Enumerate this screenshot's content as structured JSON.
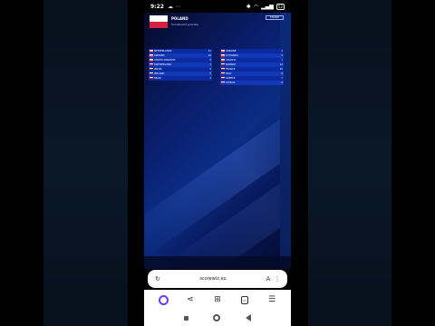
{
  "status": {
    "time": "9:22",
    "battery": "52"
  },
  "site": {
    "country": "POLAND",
    "subtitle": "Scoreboard preview",
    "header_button": "SHARE"
  },
  "scores_left": [
    {
      "name": "NETHERLANDS",
      "pts": "12"
    },
    {
      "name": "SWEDEN",
      "pts": "10"
    },
    {
      "name": "UNITED KINGDOM",
      "pts": "8"
    },
    {
      "name": "SWITZERLAND",
      "pts": "7"
    },
    {
      "name": "ISRAEL",
      "pts": "6"
    },
    {
      "name": "IRELAND",
      "pts": "5"
    },
    {
      "name": "SPAIN",
      "pts": "4"
    }
  ],
  "scores_right": [
    {
      "name": "UKRAINE",
      "pts": "3"
    },
    {
      "name": "LITHUANIA",
      "pts": "2"
    },
    {
      "name": "CROATIA",
      "pts": "1"
    },
    {
      "name": "NORWAY",
      "pts": "12"
    },
    {
      "name": "FRANCE",
      "pts": "10"
    },
    {
      "name": "ITALY",
      "pts": "8"
    },
    {
      "name": "GREECE",
      "pts": "7"
    },
    {
      "name": "CYPRUS",
      "pts": "6"
    }
  ],
  "browser": {
    "url": "scorewiz.eu"
  }
}
